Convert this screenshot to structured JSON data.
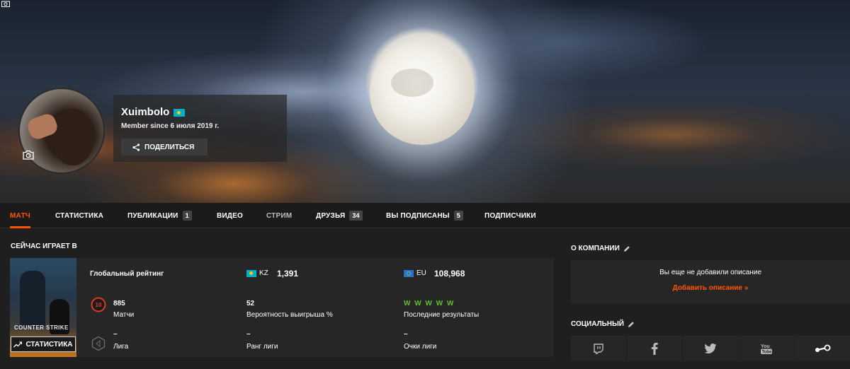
{
  "profile": {
    "username": "Xuimbolo",
    "member_since": "Member since 6 июля 2019 г.",
    "share_label": "ПОДЕЛИТЬСЯ"
  },
  "nav": {
    "tabs": [
      {
        "label": "МАТЧ",
        "active": true
      },
      {
        "label": "СТАТИСТИКА"
      },
      {
        "label": "ПУБЛИКАЦИИ",
        "badge": "1"
      },
      {
        "label": "ВИДЕО"
      },
      {
        "label": "СТРИМ"
      },
      {
        "label": "ДРУЗЬЯ",
        "badge": "34"
      },
      {
        "label": "ВЫ ПОДПИСАНЫ",
        "badge": "5"
      },
      {
        "label": "ПОДПИСЧИКИ"
      }
    ]
  },
  "playing": {
    "section_title": "СЕЙЧАС ИГРАЕТ В",
    "game_logo_text": "COUNTER STRIKE",
    "stats_button": "СТАТИСТИКА",
    "global_rating_label": "Глобальный рейтинг",
    "kz_region": "KZ",
    "kz_rank": "1,391",
    "eu_region": "EU",
    "eu_rank": "108,968",
    "level": "10",
    "matches_value": "885",
    "matches_label": "Матчи",
    "winrate_value": "52",
    "winrate_label": "Вероятность выигрыша %",
    "results_value": "W W W W W",
    "results_label": "Последние результаты",
    "league_value": "–",
    "league_label": "Лига",
    "league_rank_value": "–",
    "league_rank_label": "Ранг лиги",
    "league_points_value": "–",
    "league_points_label": "Очки лиги"
  },
  "about": {
    "title": "О КОМПАНИИ",
    "empty_text": "Вы еще не добавили описание",
    "add_link": "Добавить описание »"
  },
  "social": {
    "title": "СОЦИАЛЬНЫЙ",
    "icons": [
      "twitch-icon",
      "facebook-icon",
      "twitter-icon",
      "youtube-icon",
      "steam-icon"
    ]
  },
  "colors": {
    "accent": "#ff5500",
    "win": "#5fbf2f",
    "flag_kz": "#00afca",
    "level_red": "#e03a1e"
  }
}
